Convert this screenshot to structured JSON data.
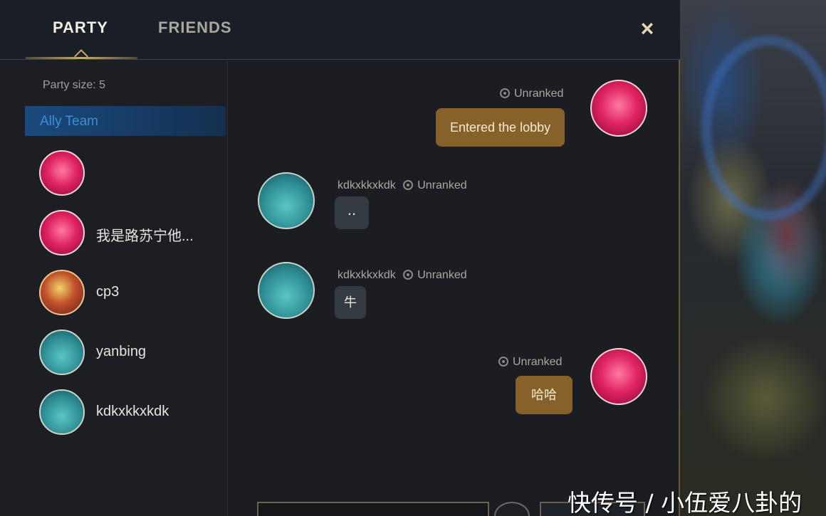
{
  "tabs": {
    "party": "PARTY",
    "friends": "FRIENDS"
  },
  "close_icon": "×",
  "sidebar": {
    "party_size": "Party size: 5",
    "team_label": "Ally Team",
    "members": [
      {
        "name": "",
        "avatar": "heart-avatar"
      },
      {
        "name": "我是路苏宁他...",
        "avatar": "heart-avatar"
      },
      {
        "name": "cp3",
        "avatar": "cp3-avatar"
      },
      {
        "name": "yanbing",
        "avatar": "poro-avatar"
      },
      {
        "name": "kdkxkkxkdk",
        "avatar": "poro-avatar"
      }
    ]
  },
  "chat": {
    "messages": [
      {
        "side": "mine",
        "meta": "Unranked",
        "text": "Entered the lobby"
      },
      {
        "side": "theirs",
        "sender": "kdkxkkxkdk",
        "meta": "Unranked",
        "text": ".."
      },
      {
        "side": "theirs",
        "sender": "kdkxkkxkdk",
        "meta": "Unranked",
        "text": "牛"
      },
      {
        "side": "mine",
        "meta": "Unranked",
        "text": "哈哈"
      }
    ]
  },
  "watermark": "快传号 / 小伍爱八卦的",
  "colors": {
    "accent_gold": "#c8aa6e",
    "my_bubble": "#86612a",
    "their_bubble": "#343a41",
    "ally_team": "#1a4a7e"
  }
}
